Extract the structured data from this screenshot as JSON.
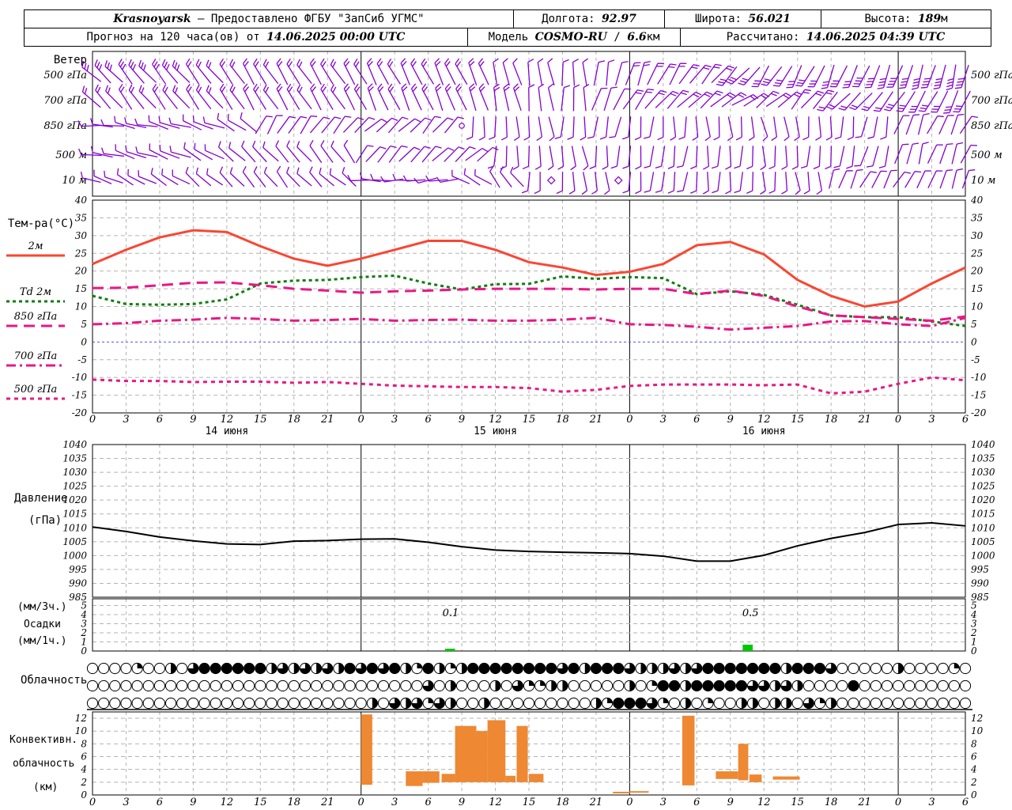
{
  "header": {
    "station": "Krasnoyarsk",
    "provider": "— Предоставлено ФГБУ \"ЗапСиб УГМС\"",
    "lon_label": "Долгота:",
    "lon": "92.97",
    "lat_label": "Широта:",
    "lat": "56.021",
    "alt_label": "Высота:",
    "alt": "189",
    "alt_unit": "м",
    "forecast_label": "Прогноз на 120 часа(ов) от",
    "forecast_start": "14.06.2025 00:00 UTC",
    "model_label": "Модель",
    "model": "COSMO-RU",
    "model_sep": "/",
    "model_res": "6.6",
    "model_unit": "км",
    "calc_label": "Рассчитано:",
    "calc_time": "14.06.2025 04:39 UTC"
  },
  "colors": {
    "barb": "#8400d0",
    "temp2m": "#fa4632",
    "td2m": "#0f7d0f",
    "pink": "#e81884",
    "zero_line": "#5050ff",
    "pressure": "#000000",
    "precip": "#00c800",
    "convective": "#ee8833",
    "grid": "#b3b3b3"
  },
  "time_axis": {
    "total_hours": 78,
    "step_hours": 3,
    "hour_labels": [
      "0",
      "3",
      "6",
      "9",
      "12",
      "15",
      "18",
      "21",
      "0",
      "3",
      "6",
      "9",
      "12",
      "15",
      "18",
      "21",
      "0",
      "3",
      "6",
      "9",
      "12",
      "15",
      "18",
      "21",
      "0",
      "3",
      "6"
    ],
    "day_line_hours": [
      24,
      48,
      72
    ],
    "date_labels": [
      {
        "label": "14 июня",
        "hour": 12
      },
      {
        "label": "15 июня",
        "hour": 36
      },
      {
        "label": "16 июня",
        "hour": 60
      }
    ]
  },
  "wind": {
    "title": "Ветер",
    "levels": [
      "500 гПа",
      "700 гПа",
      "850 гПа",
      "500 м",
      "10 м"
    ],
    "rows": [
      {
        "level": "500 гПа",
        "dirs": [
          135,
          138,
          140,
          143,
          145,
          147,
          148,
          150,
          150,
          152,
          155,
          158,
          163,
          170,
          178,
          188,
          200,
          212,
          222,
          40,
          32,
          28,
          24,
          20,
          18,
          16,
          15
        ],
        "ticks": [
          3,
          3,
          3,
          2,
          2,
          2,
          2,
          2,
          2,
          2,
          2,
          2,
          1,
          1,
          1,
          1,
          2,
          2,
          2,
          3,
          3,
          3,
          3,
          4,
          4,
          4,
          4
        ],
        "calm": []
      },
      {
        "level": "700 гПа",
        "dirs": [
          138,
          140,
          142,
          144,
          146,
          147,
          149,
          151,
          153,
          155,
          158,
          161,
          166,
          173,
          182,
          200,
          215,
          226,
          231,
          236,
          230,
          220,
          45,
          38,
          32,
          28,
          25
        ],
        "ticks": [
          2,
          2,
          2,
          2,
          2,
          2,
          2,
          2,
          2,
          2,
          2,
          2,
          2,
          1,
          1,
          1,
          2,
          2,
          2,
          2,
          2,
          2,
          2,
          2,
          3,
          3,
          3
        ],
        "calm": []
      },
      {
        "level": "850 гПа",
        "dirs": [
          95,
          100,
          106,
          112,
          122,
          210,
          216,
          221,
          226,
          226,
          221,
          0,
          356,
          351,
          4,
          9,
          5,
          0,
          356,
          351,
          346,
          356,
          4,
          9,
          200,
          206,
          211
        ],
        "ticks": [
          1,
          1,
          1,
          1,
          1,
          1,
          1,
          1,
          1,
          1,
          1,
          1,
          1,
          1,
          1,
          1,
          1,
          1,
          1,
          1,
          1,
          1,
          1,
          1,
          1,
          1,
          1
        ],
        "calm": [
          33
        ]
      },
      {
        "level": "500 м",
        "dirs": [
          100,
          106,
          111,
          121,
          131,
          136,
          141,
          146,
          216,
          221,
          226,
          231,
          0,
          356,
          351,
          0,
          4,
          9,
          4,
          0,
          356,
          4,
          9,
          14,
          196,
          201,
          206
        ],
        "ticks": [
          1,
          1,
          1,
          1,
          1,
          1,
          1,
          1,
          1,
          1,
          1,
          1,
          1,
          1,
          1,
          1,
          1,
          1,
          1,
          1,
          1,
          1,
          1,
          1,
          1,
          1,
          1
        ],
        "calm": []
      },
      {
        "level": "10 м",
        "dirs": [
          111,
          116,
          121,
          131,
          136,
          141,
          136,
          131,
          91,
          86,
          81,
          121,
          141,
          0,
          356,
          351,
          4,
          9,
          4,
          0,
          356,
          351,
          201,
          206,
          211,
          201,
          196
        ],
        "ticks": [
          1,
          1,
          1,
          1,
          1,
          1,
          1,
          1,
          1,
          1,
          1,
          1,
          1,
          1,
          1,
          1,
          1,
          1,
          1,
          1,
          1,
          1,
          1,
          1,
          1,
          1,
          1
        ],
        "calm": [
          41,
          47
        ]
      }
    ]
  },
  "chart_data": [
    {
      "id": "temperature",
      "type": "line",
      "title": "Тем-ра(°C)",
      "x_hours_step": 3,
      "ylim": [
        -20,
        40
      ],
      "yticks": [
        40,
        35,
        30,
        25,
        20,
        15,
        10,
        5,
        0,
        -5,
        -10,
        -15,
        -20
      ],
      "zero_line": 0,
      "series": [
        {
          "name": "2м",
          "color": "#fa4632",
          "dash": "",
          "width": 3,
          "values": [
            22,
            26,
            29.5,
            31.5,
            31,
            27,
            23.5,
            21.5,
            23.5,
            26,
            28.5,
            28.5,
            26,
            22.5,
            21,
            18.9,
            19.8,
            22,
            27.3,
            28.2,
            24.7,
            17.5,
            13,
            10,
            11.4,
            16.5,
            21
          ]
        },
        {
          "name": "Td 2м",
          "color": "#0f7d0f",
          "dash": "4,4",
          "width": 3,
          "values": [
            13,
            10.7,
            10.5,
            10.7,
            12,
            16.5,
            17.3,
            17.5,
            18.3,
            18.7,
            16.5,
            14.8,
            16.3,
            16.4,
            18.5,
            17.8,
            18.3,
            18,
            13.5,
            14.3,
            13.3,
            10.5,
            7.5,
            7,
            7,
            5.8,
            4.5
          ]
        },
        {
          "name": "850 гПа",
          "color": "#e81884",
          "dash": "14,8",
          "width": 3,
          "values": [
            15.2,
            15.3,
            16,
            16.7,
            16.8,
            16,
            15,
            14.5,
            13.9,
            14.3,
            14.5,
            14.8,
            15,
            15,
            15,
            14.8,
            15,
            15,
            13.5,
            14.5,
            13,
            10,
            7.5,
            7,
            6.5,
            6,
            7.2
          ]
        },
        {
          "name": "700 гПа",
          "color": "#e81884",
          "dash": "12,5,3,5",
          "width": 3,
          "values": [
            5,
            5.3,
            6,
            6.3,
            6.8,
            6.5,
            6,
            6.2,
            6.5,
            6,
            6.2,
            6.3,
            6,
            6,
            6.3,
            6.8,
            5,
            4.8,
            4.3,
            3.5,
            4,
            4.5,
            5.8,
            5.9,
            5,
            4.5,
            6.8
          ]
        },
        {
          "name": "500 гПа",
          "color": "#e81884",
          "dash": "5,5",
          "width": 3,
          "values": [
            -10.6,
            -11,
            -11,
            -11.3,
            -11.2,
            -11.2,
            -11.5,
            -11.3,
            -11.8,
            -12.3,
            -12.5,
            -12.7,
            -12.7,
            -13,
            -14,
            -13.5,
            -12.4,
            -12,
            -12,
            -12,
            -12.2,
            -12,
            -14.5,
            -14,
            -11.8,
            -10,
            -10.8
          ]
        }
      ]
    },
    {
      "id": "pressure",
      "type": "line",
      "title_lines": [
        "Давление",
        "(гПа)"
      ],
      "x_hours_step": 3,
      "ylim": [
        985,
        1040
      ],
      "yticks": [
        1040,
        1035,
        1030,
        1025,
        1020,
        1015,
        1010,
        1005,
        1000,
        995,
        990,
        985
      ],
      "series": [
        {
          "name": "Давление",
          "color": "#000000",
          "dash": "",
          "width": 2,
          "values": [
            1010.3,
            1008.7,
            1006.7,
            1005.3,
            1004.2,
            1004,
            1005.2,
            1005.4,
            1005.9,
            1006,
            1004.8,
            1003.2,
            1002,
            1001.5,
            1001.2,
            1001,
            1000.7,
            999.8,
            998,
            998,
            1000.1,
            1003.5,
            1006.2,
            1008.3,
            1011.2,
            1011.8,
            1010.7
          ]
        }
      ]
    },
    {
      "id": "precipitation",
      "type": "bar",
      "title_lines": [
        "(мм/3ч.)",
        "Осадки",
        "(мм/1ч.)"
      ],
      "ylim": [
        0,
        5.7
      ],
      "yticks": [
        5,
        4,
        3,
        2,
        1,
        0
      ],
      "color": "#00c800",
      "bars": [
        {
          "hour_start": 31.5,
          "hour_end": 32.4,
          "mm": 0.25,
          "label": "0.1",
          "label_hour": 32
        },
        {
          "hour_start": 58.1,
          "hour_end": 59.0,
          "mm": 0.7,
          "label": "0.5",
          "label_hour": 58.8
        }
      ]
    },
    {
      "id": "cloud_cover",
      "type": "symbols",
      "title": "Облачность",
      "note": "per-hour cloud circles, digits = quarters filled 0..4",
      "rows": [
        "0000100203444444232323243434214212444444443424443222323444444424443000002000010100",
        "0000000000000000000000000000003020002031122000002014424444433232000040000000000",
        "0000000000000000000000000203231320020000000002144431020100220220312000000000000"
      ]
    },
    {
      "id": "convective_cloud",
      "type": "range-bar",
      "title_lines": [
        "Конвективн.",
        "облачность",
        "(км)"
      ],
      "ylim": [
        0,
        13
      ],
      "yticks": [
        12,
        10,
        8,
        6,
        4,
        2,
        0
      ],
      "color": "#ee8833",
      "bars": [
        [
          24,
          25,
          1.6,
          12.6
        ],
        [
          28,
          29.5,
          1.4,
          3.7
        ],
        [
          29.5,
          31,
          1.9,
          3.7
        ],
        [
          31.2,
          32.4,
          2,
          3.3
        ],
        [
          32.4,
          34.3,
          2,
          10.8
        ],
        [
          34.3,
          35.3,
          2,
          10
        ],
        [
          35.3,
          36.9,
          2,
          11.7
        ],
        [
          36.9,
          37.8,
          2,
          3
        ],
        [
          37.9,
          38.9,
          2,
          10.8
        ],
        [
          39,
          40.3,
          2,
          3.3
        ],
        [
          46.5,
          48,
          0.25,
          0.5
        ],
        [
          48,
          49.7,
          0.35,
          0.6
        ],
        [
          52.7,
          53.8,
          1.5,
          12.4
        ],
        [
          55.7,
          57.7,
          2.5,
          3.7
        ],
        [
          57.7,
          58.6,
          2.3,
          8
        ],
        [
          58.7,
          59.8,
          2,
          3.2
        ],
        [
          60.8,
          63.2,
          2.4,
          2.9
        ]
      ]
    }
  ]
}
